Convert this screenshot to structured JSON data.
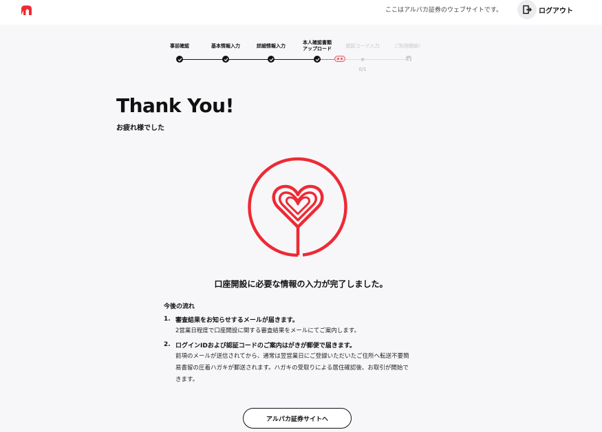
{
  "header": {
    "site_note": "ここはアルパカ証券のウェブサイトです。",
    "logout_label": "ログアウト",
    "brand_color": "#ee2a35"
  },
  "stepper": {
    "steps": [
      {
        "label": "事前確認",
        "state": "done"
      },
      {
        "label": "基本情報入力",
        "state": "done"
      },
      {
        "label": "詳細情報入力",
        "state": "done"
      },
      {
        "label": "本人確認書類\nアップロード",
        "state": "done"
      },
      {
        "label": "認証コード入力",
        "state": "pending"
      },
      {
        "label": "ご利用開始！",
        "state": "pending"
      }
    ],
    "sub_count": "0/1"
  },
  "main": {
    "title": "Thank You!",
    "subtitle": "お疲れ様でした",
    "complete_message": "口座開設に必要な情報の入力が完了しました。",
    "next_title": "今後の流れ",
    "next_items": [
      {
        "num": "1.",
        "head": "審査結果をお知らせするメールが届きます。",
        "body": "2営業日程度で口座開設に関する審査結果をメールにてご案内します。"
      },
      {
        "num": "2.",
        "head": "ログインIDおよび認証コードのご案内はがきが郵便で届きます。",
        "body": "前項のメールが送信されてから、通常は翌営業日にご登録いただいたご住所へ転送不要簡\n易書留の圧着ハガキが郵送されます。ハガキの受取りによる居住確認後、お取引が開始で\nきます。"
      }
    ],
    "cta_label": "アルパカ証券サイトへ"
  }
}
